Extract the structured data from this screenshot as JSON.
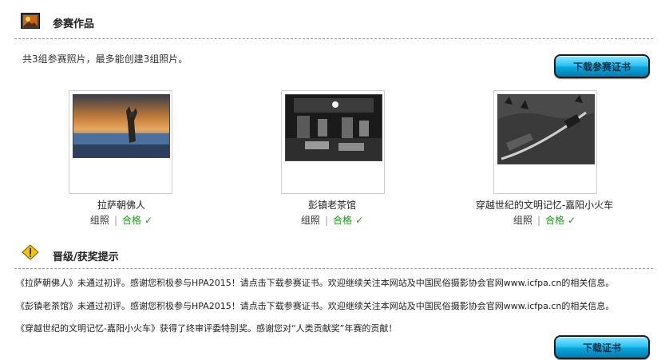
{
  "entries_section": {
    "title": "参赛作品",
    "icon": "picture-frame-icon",
    "intro": "共3组参赛照片，最多能创建3组照片。",
    "download_button": "下载参赛证书"
  },
  "entries": [
    {
      "title": "拉萨朝佛人",
      "type": "组照",
      "status": "合格",
      "status_icon": "check-icon"
    },
    {
      "title": "彭镇老茶馆",
      "type": "组照",
      "status": "合格",
      "status_icon": "check-icon"
    },
    {
      "title": "穿越世纪的文明记忆-嘉阳小火车",
      "type": "组照",
      "status": "合格",
      "status_icon": "check-icon"
    }
  ],
  "award_section": {
    "title": "晋级/获奖提示",
    "icon": "warning-icon",
    "notices": [
      "《拉萨朝佛人》未通过初评。感谢您积极参与HPA2015！请点击下载参赛证书。欢迎继续关注本网站及中国民俗摄影协会官网www.icfpa.cn的相关信息。",
      "《彭镇老茶馆》未通过初评。感谢您积极参与HPA2015！请点击下载参赛证书。欢迎继续关注本网站及中国民俗摄影协会官网www.icfpa.cn的相关信息。",
      "《穿越世纪的文明记忆-嘉阳小火车》获得了终审评委特别奖。感谢您对“人类贡献奖”年赛的贡献！"
    ],
    "download_button": "下载证书"
  },
  "colors": {
    "button_top": "#8ee7ff",
    "button_bottom": "#057bb0",
    "pass_green": "#1a9e1a",
    "warning_yellow": "#f5c400"
  }
}
